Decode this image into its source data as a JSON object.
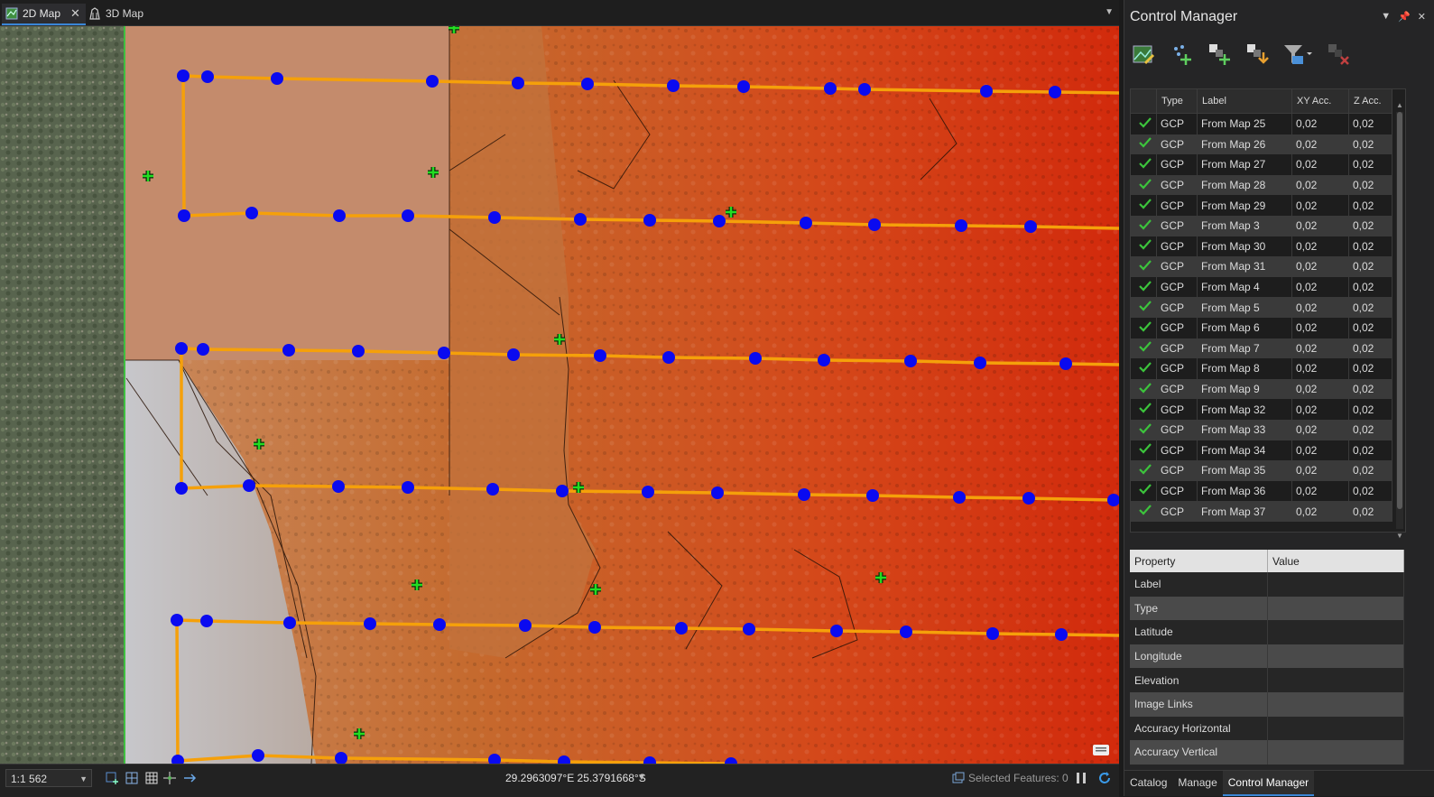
{
  "map_tabs": [
    {
      "label": "2D Map",
      "active": true
    },
    {
      "label": "3D Map",
      "active": false
    }
  ],
  "status": {
    "scale": "1:1 562",
    "coordinates": "29.2963097°E 25.3791668°S",
    "selected_features": "Selected Features: 0"
  },
  "panel": {
    "title": "Control Manager",
    "table_headers": {
      "type": "Type",
      "label": "Label",
      "xy": "XY Acc.",
      "z": "Z Acc."
    },
    "gcps": [
      {
        "type": "GCP",
        "label": "From Map 25",
        "xy": "0,02",
        "z": "0,02"
      },
      {
        "type": "GCP",
        "label": "From Map 26",
        "xy": "0,02",
        "z": "0,02"
      },
      {
        "type": "GCP",
        "label": "From Map 27",
        "xy": "0,02",
        "z": "0,02"
      },
      {
        "type": "GCP",
        "label": "From Map 28",
        "xy": "0,02",
        "z": "0,02"
      },
      {
        "type": "GCP",
        "label": "From Map 29",
        "xy": "0,02",
        "z": "0,02"
      },
      {
        "type": "GCP",
        "label": "From Map 3",
        "xy": "0,02",
        "z": "0,02"
      },
      {
        "type": "GCP",
        "label": "From Map 30",
        "xy": "0,02",
        "z": "0,02"
      },
      {
        "type": "GCP",
        "label": "From Map 31",
        "xy": "0,02",
        "z": "0,02"
      },
      {
        "type": "GCP",
        "label": "From Map 4",
        "xy": "0,02",
        "z": "0,02"
      },
      {
        "type": "GCP",
        "label": "From Map 5",
        "xy": "0,02",
        "z": "0,02"
      },
      {
        "type": "GCP",
        "label": "From Map 6",
        "xy": "0,02",
        "z": "0,02"
      },
      {
        "type": "GCP",
        "label": "From Map 7",
        "xy": "0,02",
        "z": "0,02"
      },
      {
        "type": "GCP",
        "label": "From Map 8",
        "xy": "0,02",
        "z": "0,02"
      },
      {
        "type": "GCP",
        "label": "From Map 9",
        "xy": "0,02",
        "z": "0,02"
      },
      {
        "type": "GCP",
        "label": "From Map 32",
        "xy": "0,02",
        "z": "0,02"
      },
      {
        "type": "GCP",
        "label": "From Map 33",
        "xy": "0,02",
        "z": "0,02"
      },
      {
        "type": "GCP",
        "label": "From Map 34",
        "xy": "0,02",
        "z": "0,02"
      },
      {
        "type": "GCP",
        "label": "From Map 35",
        "xy": "0,02",
        "z": "0,02"
      },
      {
        "type": "GCP",
        "label": "From Map 36",
        "xy": "0,02",
        "z": "0,02"
      },
      {
        "type": "GCP",
        "label": "From Map 37",
        "xy": "0,02",
        "z": "0,02"
      }
    ],
    "property_headers": {
      "property": "Property",
      "value": "Value"
    },
    "properties": [
      "Label",
      "Type",
      "Latitude",
      "Longitude",
      "Elevation",
      "Image Links",
      "Accuracy Horizontal",
      "Accuracy Vertical"
    ],
    "bottom_tabs": [
      {
        "label": "Catalog",
        "active": false
      },
      {
        "label": "Manage",
        "active": false
      },
      {
        "label": "Control Manager",
        "active": true
      }
    ]
  },
  "colors": {
    "flight_line": "#f5a00a",
    "tie_point": "#0a0af0",
    "gcp_marker": "#22dd22",
    "check_mark": "#3cc43c"
  },
  "icons": {
    "map_tab_2d": "map-2d-icon",
    "map_tab_3d": "map-3d-icon",
    "gcp_status": "check-icon"
  }
}
